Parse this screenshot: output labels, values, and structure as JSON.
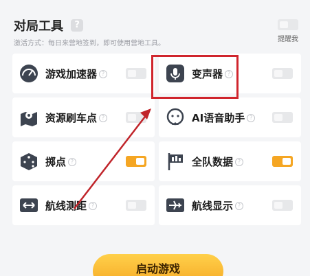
{
  "header": {
    "title": "对局工具",
    "help_glyph": "?",
    "subtitle": "激活方式：每日来营地签到，即可使用营地工具。",
    "remind_label": "提醒我",
    "remind_on": false
  },
  "tools": [
    {
      "label": "游戏加速器",
      "icon": "speedometer-icon",
      "on": false
    },
    {
      "label": "变声器",
      "icon": "microphone-icon",
      "on": false
    },
    {
      "label": "资源刷车点",
      "icon": "map-pin-icon",
      "on": false
    },
    {
      "label": "AI语音助手",
      "icon": "voice-assistant-icon",
      "on": false
    },
    {
      "label": "掷点",
      "icon": "dice-icon",
      "on": true
    },
    {
      "label": "全队数据",
      "icon": "team-flag-icon",
      "on": true
    },
    {
      "label": "航线测距",
      "icon": "route-distance-icon",
      "on": false
    },
    {
      "label": "航线显示",
      "icon": "airplane-icon",
      "on": false
    }
  ],
  "help_mark": "?",
  "start_button": {
    "label": "启动游戏"
  },
  "colors": {
    "accent": "#f5a623",
    "highlight": "#d0252d",
    "arrow": "#c0242a"
  }
}
